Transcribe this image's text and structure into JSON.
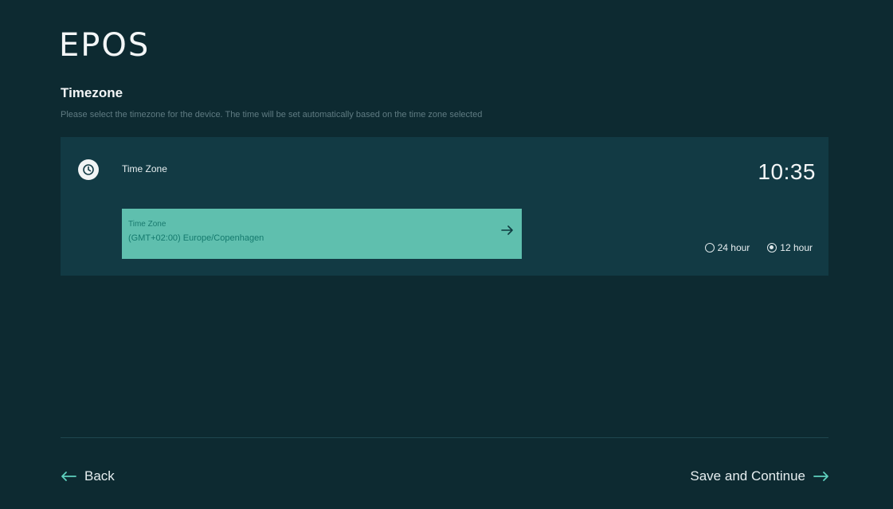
{
  "brand": {
    "logo_text": "EPOS"
  },
  "page": {
    "title": "Timezone",
    "subtitle": "Please select the timezone for the device. The time will be set automatically based on the time zone selected"
  },
  "card": {
    "icon": "clock-icon",
    "label": "Time Zone",
    "clock": "10:35",
    "select": {
      "label": "Time Zone",
      "value": "(GMT+02:00) Europe/Copenhagen",
      "icon": "arrow-right-icon"
    },
    "format": {
      "options": [
        {
          "label": "24 hour",
          "selected": false
        },
        {
          "label": "12 hour",
          "selected": true
        }
      ]
    }
  },
  "footer": {
    "back_label": "Back",
    "next_label": "Save and Continue",
    "accent": "#5fd1bf"
  },
  "colors": {
    "background": "#0d2a31",
    "card": "#123a44",
    "select": "#5fbfae"
  }
}
